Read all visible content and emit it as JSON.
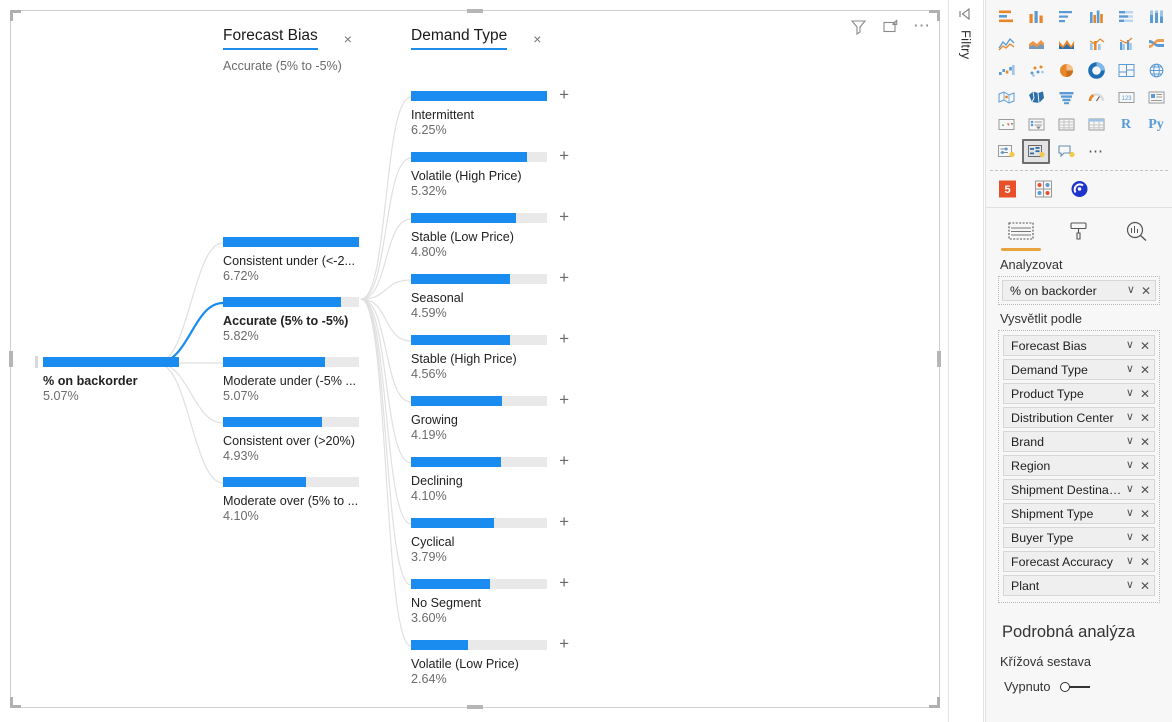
{
  "visual": {
    "actions": [
      {
        "name": "filter-icon",
        "title": "Filtr"
      },
      {
        "name": "focus-mode-icon",
        "title": "Režim zaměření"
      },
      {
        "name": "more-options-icon",
        "title": "Další možnosti"
      }
    ]
  },
  "tree": {
    "root": {
      "label": "% on backorder",
      "value": "5.07%",
      "fill_pct": 100,
      "selected": true
    },
    "levels": [
      {
        "title": "Forecast Bias",
        "subtitle": "Accurate (5% to -5%)",
        "close_label": "×",
        "nodes": [
          {
            "label": "Consistent under (<-2...",
            "value": "6.72%",
            "fill_pct": 100,
            "selected": false,
            "expandable": false
          },
          {
            "label": "Accurate (5% to -5%)",
            "value": "5.82%",
            "fill_pct": 87,
            "selected": true,
            "expandable": false
          },
          {
            "label": "Moderate under (-5% ...",
            "value": "5.07%",
            "fill_pct": 75,
            "selected": false,
            "expandable": false
          },
          {
            "label": "Consistent over (>20%)",
            "value": "4.93%",
            "fill_pct": 73,
            "selected": false,
            "expandable": false
          },
          {
            "label": "Moderate over (5% to ...",
            "value": "4.10%",
            "fill_pct": 61,
            "selected": false,
            "expandable": false
          }
        ]
      },
      {
        "title": "Demand Type",
        "subtitle": "",
        "close_label": "×",
        "nodes": [
          {
            "label": "Intermittent",
            "value": "6.25%",
            "fill_pct": 100,
            "selected": false,
            "expandable": true,
            "expand_label": "+"
          },
          {
            "label": "Volatile (High Price)",
            "value": "5.32%",
            "fill_pct": 85,
            "selected": false,
            "expandable": true,
            "expand_label": "+"
          },
          {
            "label": "Stable (Low Price)",
            "value": "4.80%",
            "fill_pct": 77,
            "selected": false,
            "expandable": true,
            "expand_label": "+"
          },
          {
            "label": "Seasonal",
            "value": "4.59%",
            "fill_pct": 73,
            "selected": false,
            "expandable": true,
            "expand_label": "+"
          },
          {
            "label": "Stable (High Price)",
            "value": "4.56%",
            "fill_pct": 73,
            "selected": false,
            "expandable": true,
            "expand_label": "+"
          },
          {
            "label": "Growing",
            "value": "4.19%",
            "fill_pct": 67,
            "selected": false,
            "expandable": true,
            "expand_label": "+"
          },
          {
            "label": "Declining",
            "value": "4.10%",
            "fill_pct": 66,
            "selected": false,
            "expandable": true,
            "expand_label": "+"
          },
          {
            "label": "Cyclical",
            "value": "3.79%",
            "fill_pct": 61,
            "selected": false,
            "expandable": true,
            "expand_label": "+"
          },
          {
            "label": "No Segment",
            "value": "3.60%",
            "fill_pct": 58,
            "selected": false,
            "expandable": true,
            "expand_label": "+"
          },
          {
            "label": "Volatile (Low Price)",
            "value": "2.64%",
            "fill_pct": 42,
            "selected": false,
            "expandable": true,
            "expand_label": "+"
          }
        ]
      }
    ]
  },
  "filters_rail": {
    "label": "Filtry"
  },
  "viz_pane": {
    "gallery_icons": [
      "stacked-bar-chart-icon",
      "stacked-column-chart-icon",
      "clustered-bar-chart-icon",
      "clustered-column-chart-icon",
      "100-stacked-bar-chart-icon",
      "100-stacked-column-chart-icon",
      "line-chart-icon",
      "area-chart-icon",
      "stacked-area-chart-icon",
      "line-stacked-column-chart-icon",
      "line-clustered-column-chart-icon",
      "ribbon-chart-icon",
      "waterfall-chart-icon",
      "scatter-chart-icon",
      "pie-chart-icon",
      "donut-chart-icon",
      "treemap-icon",
      "map-icon",
      "filled-map-icon",
      "shape-map-icon",
      "funnel-chart-icon",
      "gauge-chart-icon",
      "card-icon",
      "multi-row-card-icon",
      "kpi-icon",
      "slicer-icon",
      "table-icon",
      "matrix-icon",
      "r-script-visual-icon",
      "python-visual-icon",
      "key-influencers-icon",
      "decomposition-tree-icon",
      "qna-visual-icon",
      "more-visuals-icon"
    ],
    "selected_gallery_icon": "decomposition-tree-icon",
    "custom_icons": [
      "html-content-icon",
      "get-more-visuals-icon",
      "power-bi-visual-icon"
    ],
    "tabs": [
      {
        "name": "fields-tab",
        "icon": "fields-icon",
        "active": true
      },
      {
        "name": "format-tab",
        "icon": "paint-roller-icon",
        "active": false
      },
      {
        "name": "analytics-tab",
        "icon": "magnifier-chart-icon",
        "active": false
      }
    ],
    "analyze_label": "Analyzovat",
    "analyze_field": {
      "name": "% on backorder",
      "chevron": "∨",
      "remove": "✕"
    },
    "explain_by_label": "Vysvětlit podle",
    "explain_by_fields": [
      {
        "name": "Forecast Bias",
        "chevron": "∨",
        "remove": "✕"
      },
      {
        "name": "Demand Type",
        "chevron": "∨",
        "remove": "✕"
      },
      {
        "name": "Product Type",
        "chevron": "∨",
        "remove": "✕"
      },
      {
        "name": "Distribution Center",
        "chevron": "∨",
        "remove": "✕"
      },
      {
        "name": "Brand",
        "chevron": "∨",
        "remove": "✕"
      },
      {
        "name": "Region",
        "chevron": "∨",
        "remove": "✕"
      },
      {
        "name": "Shipment Destination",
        "chevron": "∨",
        "remove": "✕"
      },
      {
        "name": "Shipment Type",
        "chevron": "∨",
        "remove": "✕"
      },
      {
        "name": "Buyer Type",
        "chevron": "∨",
        "remove": "✕"
      },
      {
        "name": "Forecast Accuracy",
        "chevron": "∨",
        "remove": "✕"
      },
      {
        "name": "Plant",
        "chevron": "∨",
        "remove": "✕"
      }
    ],
    "drill_title": "Podrobná analýza",
    "drill_subtitle": "Křížová sestava",
    "drill_toggle_label": "Vypnuto",
    "drill_toggle_on": false
  },
  "colors": {
    "accent_blue": "#1a8cf0",
    "bar_track": "#e9e9e9",
    "link_gray": "#e0e0e0",
    "tab_underline": "#e8a33d"
  }
}
